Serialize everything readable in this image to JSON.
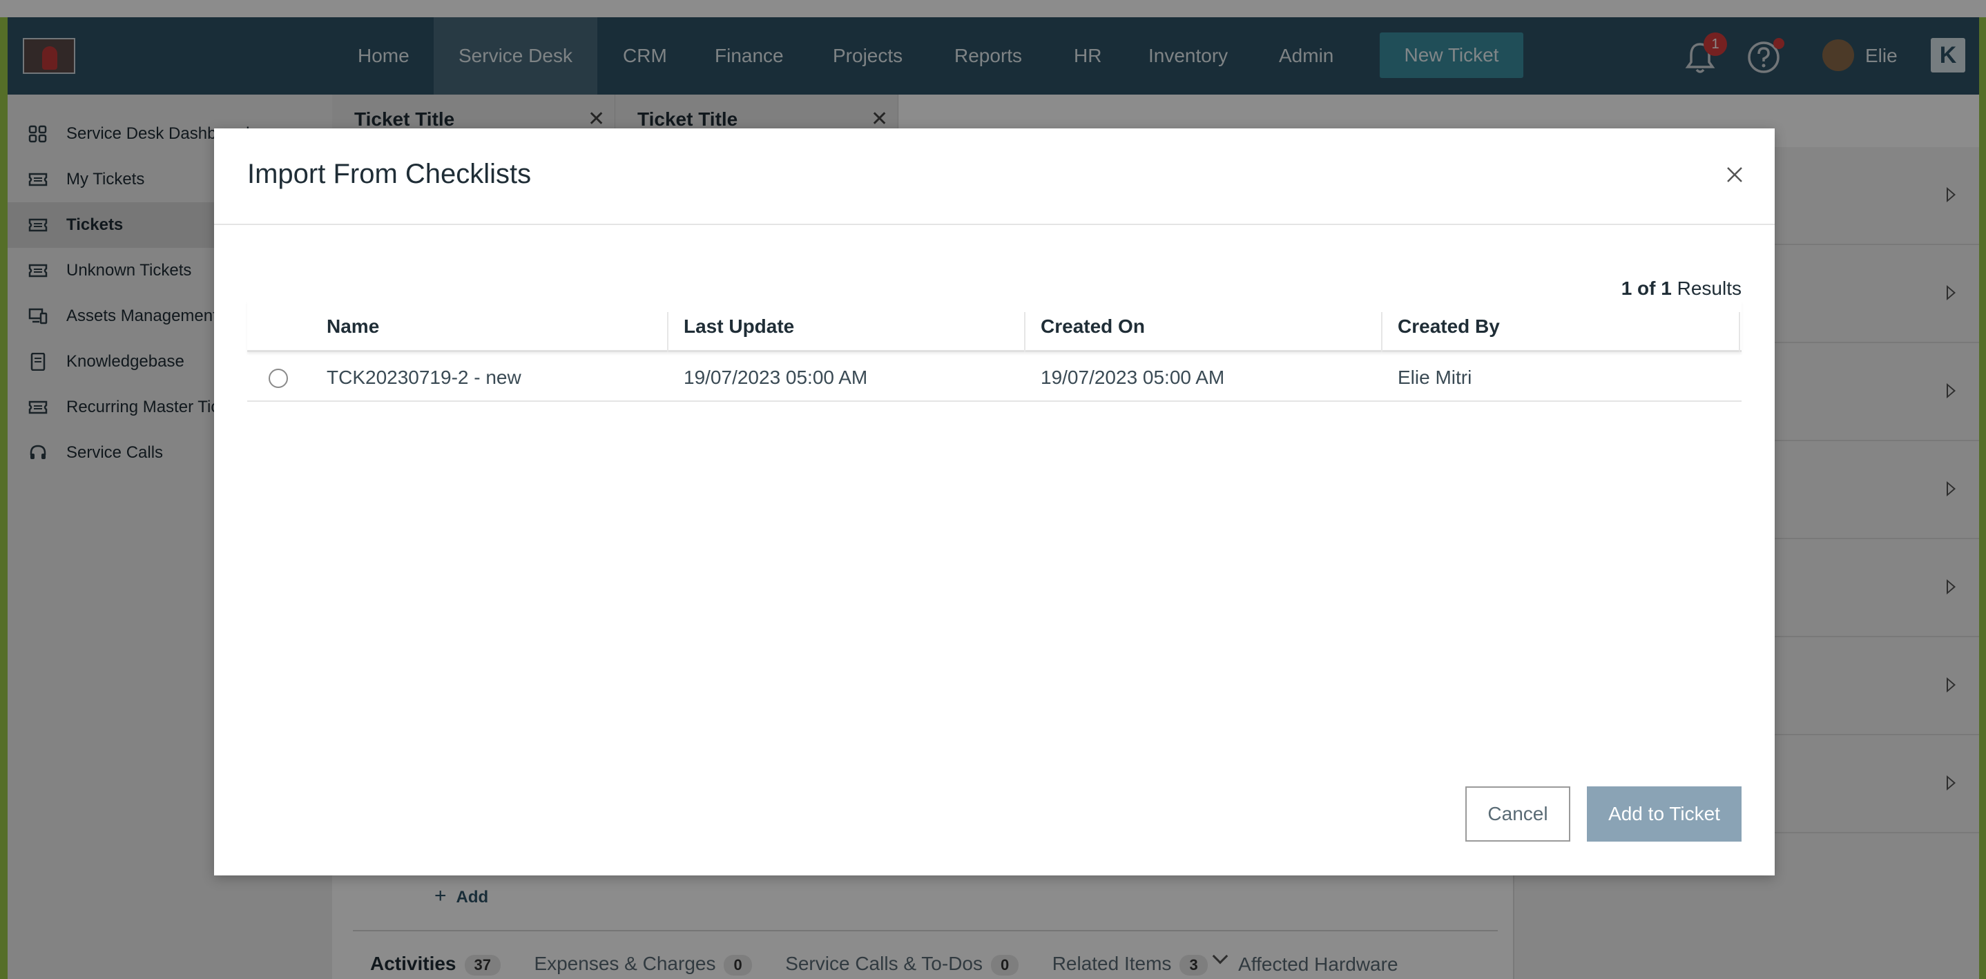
{
  "nav": {
    "items": [
      "Home",
      "Service Desk",
      "CRM",
      "Finance",
      "Projects",
      "Reports",
      "HR",
      "Inventory",
      "Admin"
    ],
    "active": "Service Desk",
    "new_ticket_label": "New Ticket",
    "notification_count": "1",
    "user_name": "Elie",
    "corner_icon": "K"
  },
  "sidebar": {
    "items": [
      {
        "label": "Service Desk Dashboard",
        "icon": "dashboard-icon"
      },
      {
        "label": "My Tickets",
        "icon": "ticket-icon"
      },
      {
        "label": "Tickets",
        "icon": "ticket-icon"
      },
      {
        "label": "Unknown Tickets",
        "icon": "ticket-icon"
      },
      {
        "label": "Assets Management",
        "icon": "devices-icon"
      },
      {
        "label": "Knowledgebase",
        "icon": "book-icon"
      },
      {
        "label": "Recurring Master Tic",
        "icon": "ticket-icon"
      },
      {
        "label": "Service Calls",
        "icon": "headset-icon"
      }
    ],
    "active": "Tickets"
  },
  "ticket_tabs": [
    {
      "title": "Ticket Title"
    },
    {
      "title": "Ticket Title"
    }
  ],
  "background": {
    "add_label": "Add",
    "bottom_tabs": [
      {
        "label": "Activities",
        "count": "37"
      },
      {
        "label": "Expenses & Charges",
        "count": "0"
      },
      {
        "label": "Service Calls & To-Dos",
        "count": "0"
      },
      {
        "label": "Related Items",
        "count": "3"
      },
      {
        "label": "Affected Hardware",
        "count": ""
      }
    ]
  },
  "modal": {
    "title": "Import From Checklists",
    "results": {
      "current": "1",
      "of": "of",
      "total": "1",
      "suffix": "Results"
    },
    "columns": [
      "Name",
      "Last Update",
      "Created On",
      "Created By"
    ],
    "rows": [
      {
        "name": "TCK20230719-2 - new",
        "last_update": "19/07/2023 05:00 AM",
        "created_on": "19/07/2023 05:00 AM",
        "created_by": "Elie Mitri"
      }
    ],
    "cancel_label": "Cancel",
    "add_label": "Add to Ticket"
  },
  "colors": {
    "nav_bg": "#2f5266",
    "accent": "#3b8ea1",
    "primary_disabled": "#8aa3b5",
    "badge": "#d63c3c",
    "frame": "#9bc94a"
  }
}
